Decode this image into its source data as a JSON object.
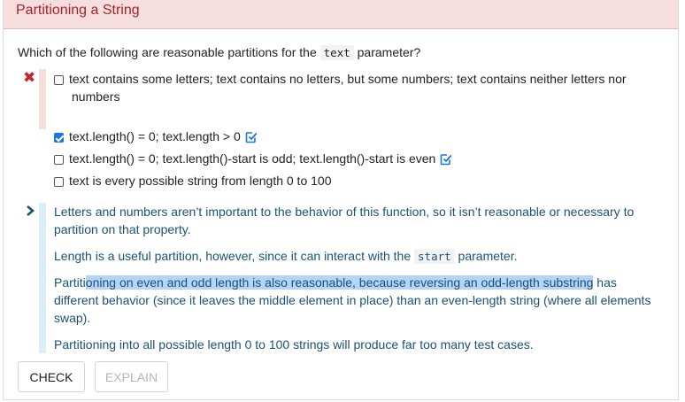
{
  "header": {
    "title": "Partitioning a String"
  },
  "question": {
    "prefix": "Which of the following are reasonable partitions for the",
    "code": "text",
    "suffix": "parameter?"
  },
  "choices": [
    {
      "text": "text contains some letters; text contains no letters, but some numbers; text contains neither letters nor",
      "text_line2": "numbers",
      "checked": false,
      "status": "wrong"
    },
    {
      "text": "text.length() = 0; text.length > 0",
      "checked": true,
      "status": "correct"
    },
    {
      "text": "text.length() = 0; text.length()-start is odd; text.length()-start is even",
      "checked": false,
      "status": "correct"
    },
    {
      "text": "text is every possible string from length 0 to 100",
      "checked": false,
      "status": "none"
    }
  ],
  "explanation": {
    "p1_line1": "Letters and numbers aren’t important to the behavior of this function, so it isn’t reasonable or necessary to",
    "p1_line2": "partition on that property.",
    "p2_prefix": "Length is a useful partition, however, since it can interact with the",
    "p2_code": "start",
    "p2_suffix": "parameter.",
    "p3_a": "Partiti",
    "p3_highlight": "oning on even and odd length is also reasonable, because reversing an odd-length substring",
    "p3_b": " has",
    "p3_line2": "different behavior (since it leaves the middle element in place) than an even-length string (where all elements",
    "p3_line3": "swap).",
    "p4": "Partitioning into all possible length 0 to 100 strings will produce far too many test cases."
  },
  "buttons": {
    "check": "CHECK",
    "explain": "EXPLAIN"
  },
  "colors": {
    "header_bg": "#f6dede",
    "header_text": "#a5242a",
    "wrong": "#c0272d",
    "correct_check": "#1a73e8",
    "explanation_text": "#1a5276",
    "highlight": "#b4d4f8"
  },
  "icons": {
    "wrong": "x-mark-icon",
    "correct": "check-square-icon",
    "expand": "chevron-right-icon"
  }
}
